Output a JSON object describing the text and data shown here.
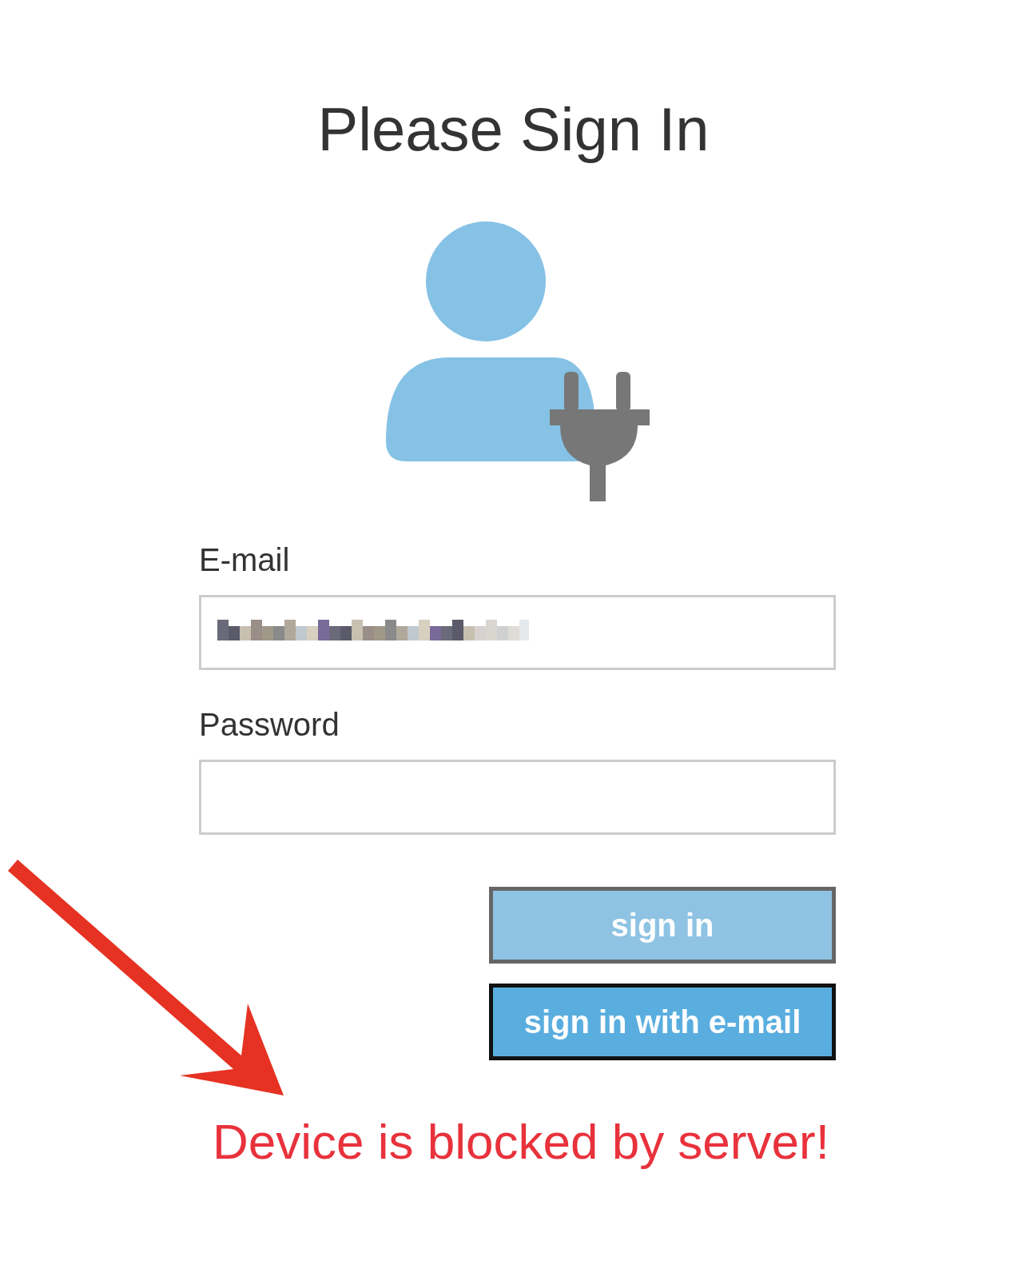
{
  "title": "Please Sign In",
  "fields": [
    {
      "label": "E-mail",
      "redacted": true
    },
    {
      "label": "Password",
      "redacted": false
    }
  ],
  "buttons": [
    {
      "label": "sign in",
      "disabled": true
    },
    {
      "label": "sign in with e-mail",
      "disabled": false
    }
  ],
  "error": "Device is blocked by server!"
}
